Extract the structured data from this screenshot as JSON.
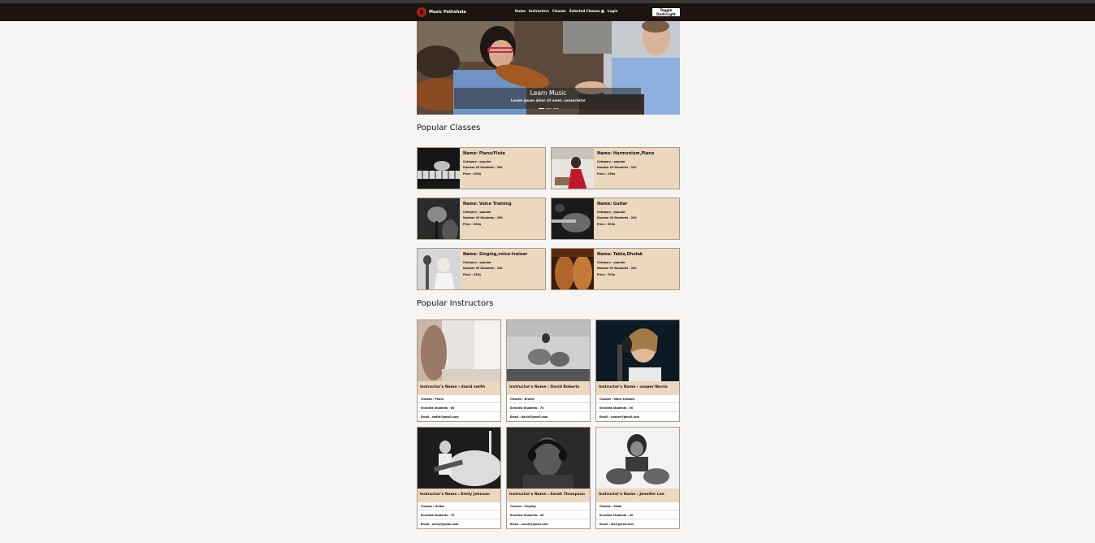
{
  "navbar": {
    "brand": "Music Pathshala",
    "links": [
      "Home",
      "Instructors",
      "Classes",
      "Selected Classes",
      "Login"
    ],
    "selected_count": "0",
    "toggle_label": "Toggle Dark/Light"
  },
  "hero": {
    "title": "Learn Music",
    "subtitle": "Lorem ipsum dolor sit amet, consectetur"
  },
  "sections": {
    "classes_title": "Popular Classes",
    "instructors_title": "Popular Instructors"
  },
  "classes": [
    {
      "name": "Name: Piano/Flute",
      "category": "Category : popular",
      "students": "Number Of Students : 300",
      "price": "Price : 200$"
    },
    {
      "name": "Name: Harmonium,Piano",
      "category": "Category : popular",
      "students": "Number Of Students : 220",
      "price": "Price : 150$"
    },
    {
      "name": "Name: Voice Training",
      "category": "Category : popular",
      "students": "Number Of Students : 200",
      "price": "Price : 300$"
    },
    {
      "name": "Name: Guitar",
      "category": "Category : popular",
      "students": "Number Of Students : 220",
      "price": "Price : 300$"
    },
    {
      "name": "Name: Singing,voice-trainer",
      "category": "Category : popular",
      "students": "Number Of Students : 240",
      "price": "Price : 150$"
    },
    {
      "name": "Name: Tabla,Dholak",
      "category": "Category : popular",
      "students": "Number Of Students : 220",
      "price": "Price : 700$"
    }
  ],
  "instructors": [
    {
      "name": "Instructor's Name : david smith",
      "classes": "Classes : Piano",
      "enrolled": "Enrolled Students : 80",
      "email": "Email : smith@gmail.com"
    },
    {
      "name": "Instructor's Name : David Roberts",
      "classes": "Classes : Drums",
      "enrolled": "Enrolled Students : 70",
      "email": "Email : david@gmail.com"
    },
    {
      "name": "Instructor's Name : cooper Norris",
      "classes": "Classes : Voice Lessons",
      "enrolled": "Enrolled Students : 30",
      "email": "Email : cooper@gmail.com"
    },
    {
      "name": "Instructor's Name : Emily Johnson",
      "classes": "Classes : Guitar",
      "enrolled": "Enrolled Students : 70",
      "email": "Email : emily@gmail.com"
    },
    {
      "name": "Instructor's Name : Sarah Thompson",
      "classes": "Classes : Singing",
      "enrolled": "Enrolled Students : 90",
      "email": "Email : sarah@gmail.com"
    },
    {
      "name": "Instructor's Name : Jennifer Lee",
      "classes": "Classes : Tabla",
      "enrolled": "Enrolled Students : 20",
      "email": "Email : lee@gmail.com"
    }
  ]
}
